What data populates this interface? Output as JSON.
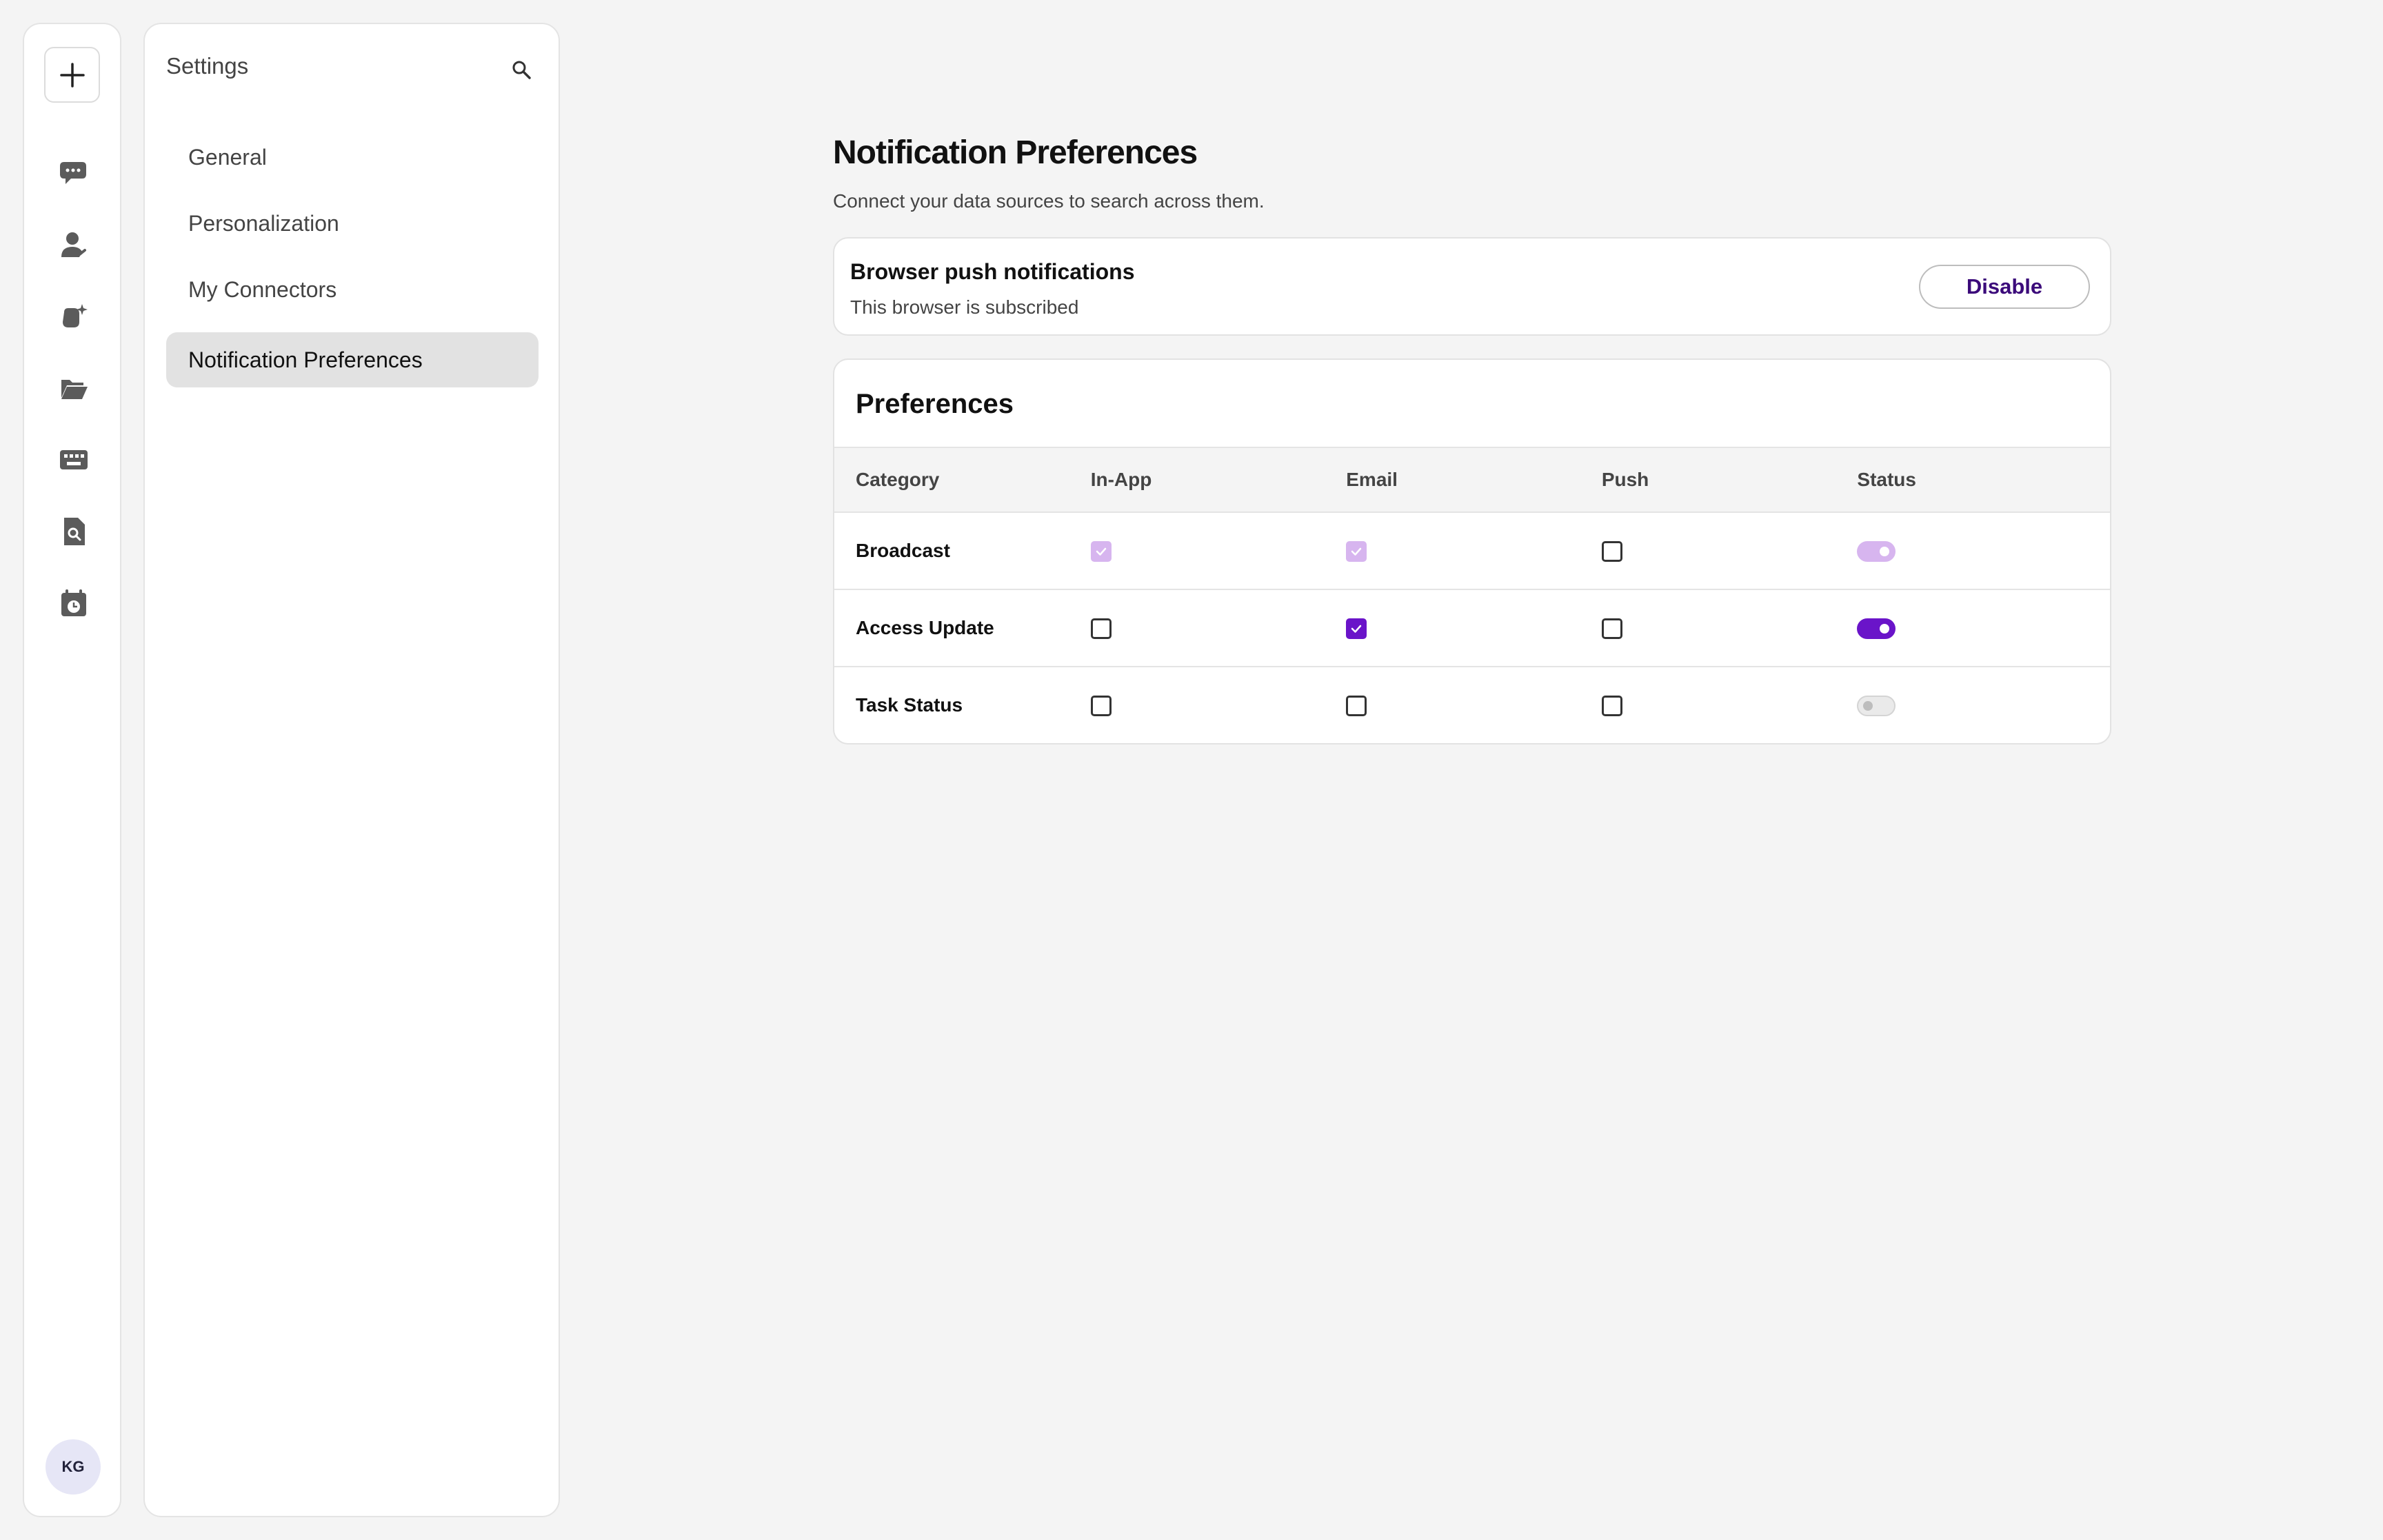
{
  "sidebar_icons": [
    "plus-icon",
    "chat-icon",
    "person-icon",
    "sparkle-icon",
    "folder-icon",
    "keyboard-icon",
    "document-search-icon",
    "calendar-clock-icon"
  ],
  "avatar": "KG",
  "settings": {
    "title": "Settings",
    "menu": [
      {
        "label": "General",
        "active": false
      },
      {
        "label": "Personalization",
        "active": false
      },
      {
        "label": "My Connectors",
        "active": false
      },
      {
        "label": "Notification Preferences",
        "active": true
      }
    ]
  },
  "main": {
    "title": "Notification Preferences",
    "subtitle": "Connect your data sources to search across them.",
    "push": {
      "title": "Browser push notifications",
      "subtitle": "This browser is subscribed",
      "button": "Disable"
    },
    "preferences": {
      "title": "Preferences",
      "columns": [
        "Category",
        "In-App",
        "Email",
        "Push",
        "Status"
      ],
      "rows": [
        {
          "category": "Broadcast",
          "in_app": "checked-disabled",
          "email": "checked-disabled",
          "push": "unchecked",
          "status": "on-disabled"
        },
        {
          "category": "Access Update",
          "in_app": "unchecked",
          "email": "checked",
          "push": "unchecked",
          "status": "on"
        },
        {
          "category": "Task Status",
          "in_app": "unchecked",
          "email": "unchecked",
          "push": "unchecked",
          "status": "off"
        }
      ]
    }
  },
  "colors": {
    "accent": "#6a14c9",
    "accent_disabled": "#d7b5ef",
    "button_text": "#3b0a7a"
  }
}
